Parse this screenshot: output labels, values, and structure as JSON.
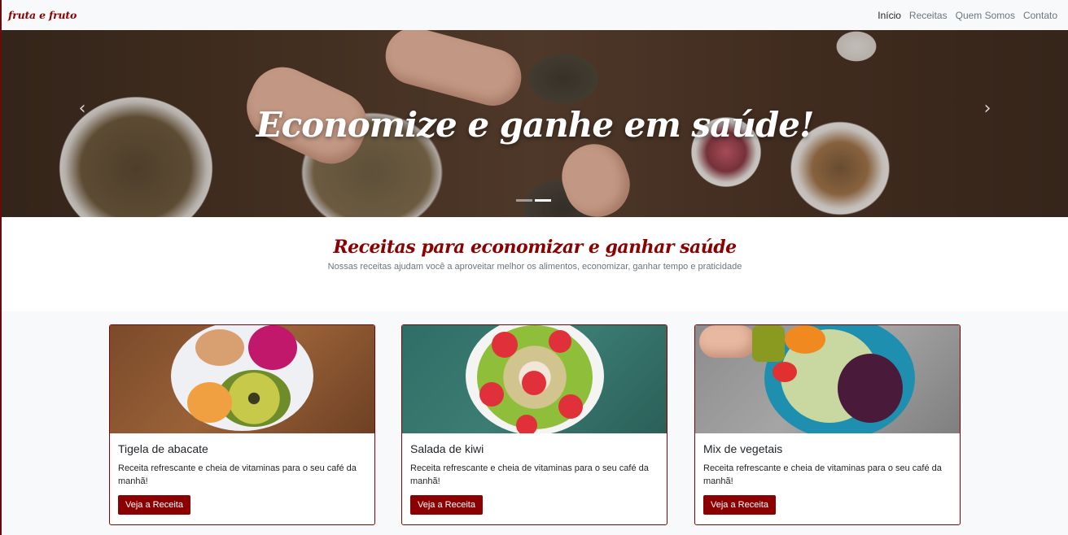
{
  "brand": "fruta e fruto",
  "nav": {
    "items": [
      "Início",
      "Receitas",
      "Quem Somos",
      "Contato"
    ],
    "active": "Início"
  },
  "hero": {
    "title": "Economize e ganhe em saúde!",
    "prev_icon": "chevron-left-icon",
    "next_icon": "chevron-right-icon",
    "slides": 2,
    "active_slide": 2
  },
  "intro": {
    "heading": "Receitas para economizar e ganhar saúde",
    "subtitle": "Nossas receitas ajudam você a aproveitar melhor os alimentos, economizar, ganhar tempo e praticidade"
  },
  "cards": [
    {
      "title": "Tigela de abacate",
      "text": "Receita refrescante e cheia de vitaminas para o seu café da manhã!",
      "button": "Veja a Receita"
    },
    {
      "title": "Salada de kiwi",
      "text": "Receita refrescante e cheia de vitaminas para o seu café da manhã!",
      "button": "Veja a Receita"
    },
    {
      "title": "Mix de vegetais",
      "text": "Receita refrescante e cheia de vitaminas para o seu café da manhã!",
      "button": "Veja a Receita"
    }
  ],
  "colors": {
    "brand": "#8b0000",
    "navbar_bg": "#f8f9fa",
    "text_muted": "#6c757d"
  }
}
